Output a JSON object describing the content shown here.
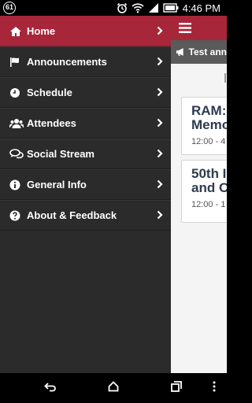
{
  "status_bar": {
    "notification_count": "61",
    "time": "4:46 PM"
  },
  "drawer": {
    "items": [
      {
        "label": "Home",
        "icon": "home-icon"
      },
      {
        "label": "Announcements",
        "icon": "flag-icon"
      },
      {
        "label": "Schedule",
        "icon": "clock-icon"
      },
      {
        "label": "Attendees",
        "icon": "group-icon"
      },
      {
        "label": "Social Stream",
        "icon": "chat-icon"
      },
      {
        "label": "General Info",
        "icon": "info-icon"
      },
      {
        "label": "About & Feedback",
        "icon": "help-icon"
      }
    ]
  },
  "content": {
    "announcement_text": "Test ann",
    "cards": [
      {
        "title_line1": "RAM:",
        "title_line2": "Memo",
        "time": "12:00 - 4"
      },
      {
        "title_line1": "50th I",
        "title_line2": "and C",
        "time": "12:00 - 1"
      }
    ]
  },
  "colors": {
    "accent": "#a8263a",
    "drawer_bg": "#2b2b2b"
  }
}
